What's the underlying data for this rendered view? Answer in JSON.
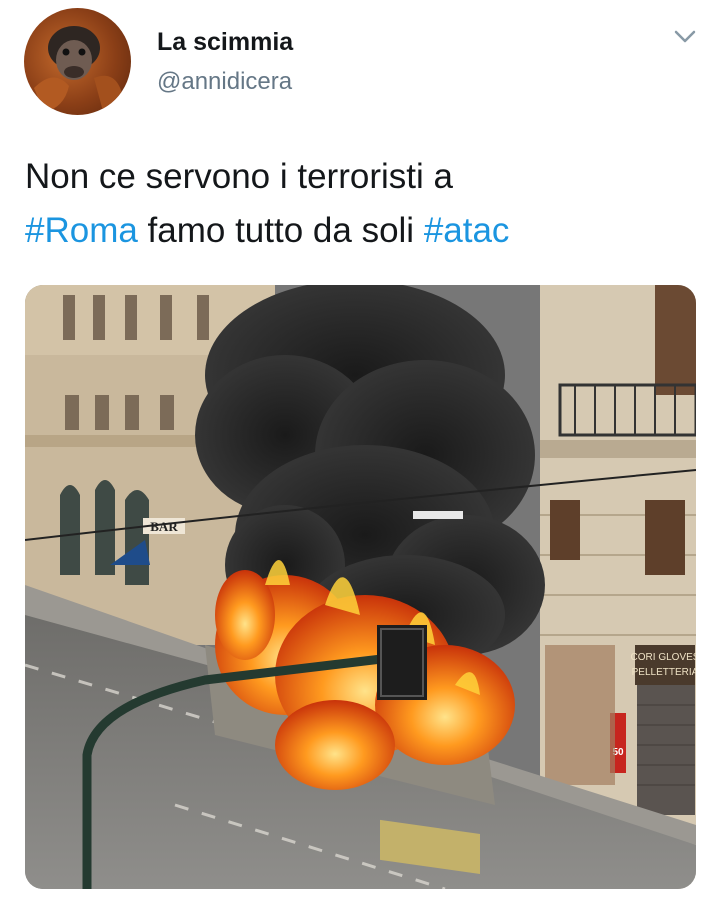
{
  "tweet": {
    "author": {
      "display_name": "La scimmia",
      "handle": "@annidicera",
      "avatar_icon": "orangutan-avatar"
    },
    "menu_icon": "chevron-down-icon",
    "text": {
      "line1": "Non ce servono i terroristi a",
      "hashtag1": "#Roma",
      "middle": " famo tutto da soli ",
      "hashtag2": "#atac"
    },
    "media": {
      "description_icon": "burning-bus-photo",
      "signs": {
        "bar": "BAR",
        "shop": "CORI GLOVES",
        "shop2": "PELLETTERIA",
        "price": "50"
      }
    }
  },
  "colors": {
    "link": "#1b95e0",
    "text": "#14171a",
    "secondary": "#657786"
  }
}
